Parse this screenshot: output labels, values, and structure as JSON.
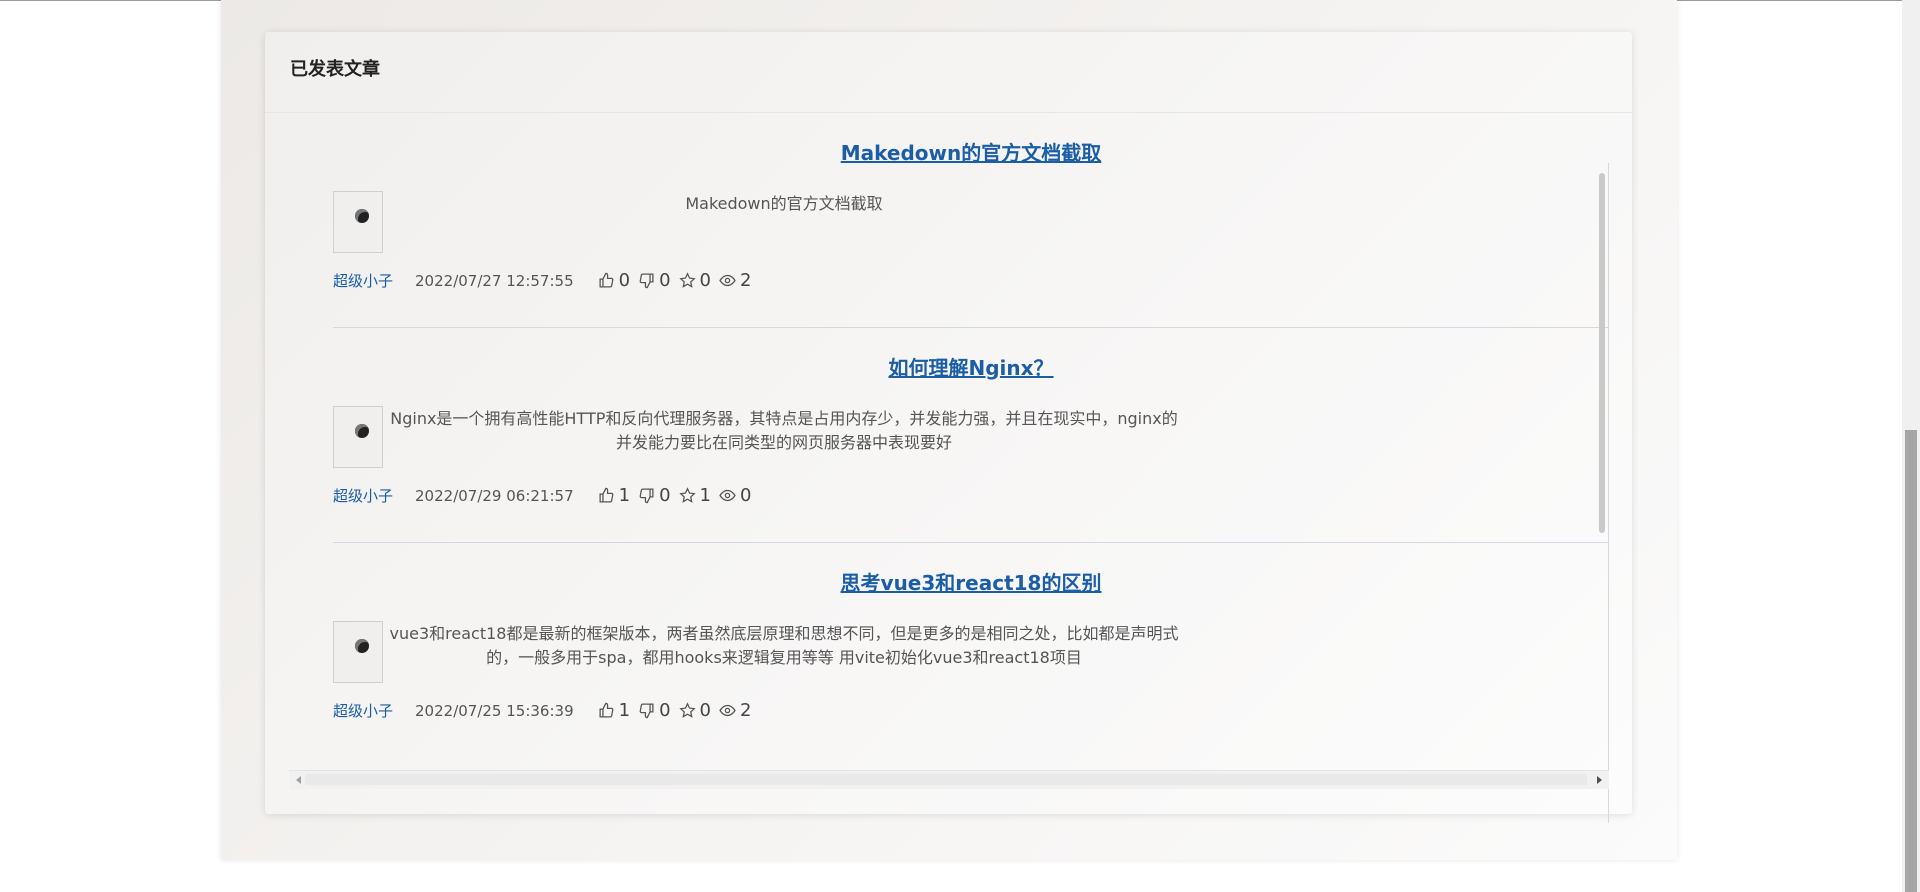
{
  "section": {
    "title": "已发表文章"
  },
  "colors": {
    "link": "#1b5ea6",
    "text": "#555555",
    "divider": "#d5d8de"
  },
  "articles": [
    {
      "title": "Makedown的官方文档截取",
      "excerpt": "Makedown的官方文档截取",
      "author": "超级小子",
      "date": "2022/07/27 12:57:55",
      "likes": "0",
      "dislikes": "0",
      "stars": "0",
      "views": "2"
    },
    {
      "title": "如何理解Nginx？",
      "excerpt": "Nginx是一个拥有高性能HTTP和反向代理服务器，其特点是占用内存少，并发能力强，并且在现实中，nginx的并发能力要比在同类型的网页服务器中表现要好",
      "author": "超级小子",
      "date": "2022/07/29 06:21:57",
      "likes": "1",
      "dislikes": "0",
      "stars": "1",
      "views": "0"
    },
    {
      "title": "思考vue3和react18的区别",
      "excerpt": "vue3和react18都是最新的框架版本，两者虽然底层原理和思想不同，但是更多的是相同之处，比如都是声明式的，一般多用于spa，都用hooks来逻辑复用等等 用vite初始化vue3和react18项目",
      "author": "超级小子",
      "date": "2022/07/25 15:36:39",
      "likes": "1",
      "dislikes": "0",
      "stars": "0",
      "views": "2"
    }
  ],
  "icons": {
    "like": "thumbs-up-icon",
    "dislike": "thumbs-down-icon",
    "star": "star-icon",
    "view": "eye-icon"
  }
}
